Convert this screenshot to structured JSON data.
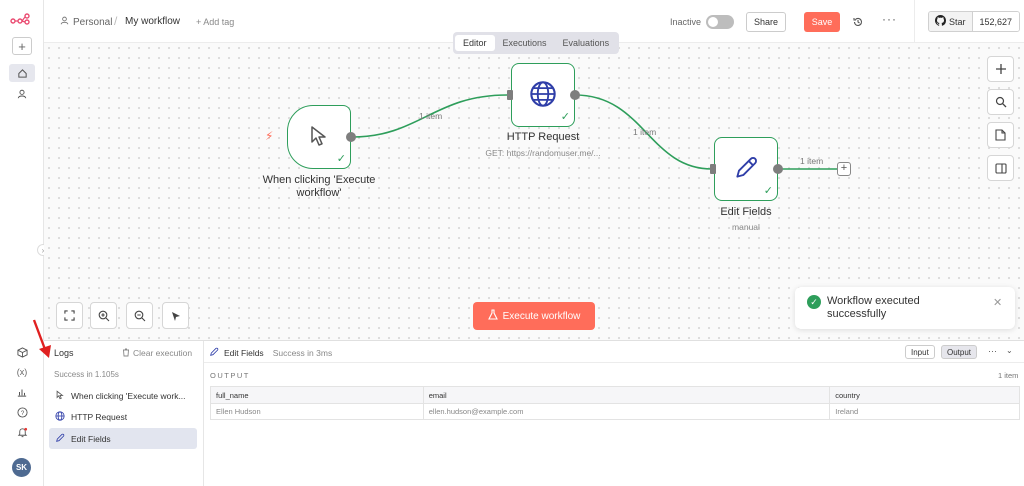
{
  "header": {
    "project": "Personal",
    "separator": "/",
    "workflow_name": "My workflow",
    "add_tag": "+ Add tag",
    "status_label": "Inactive",
    "share_label": "Share",
    "save_label": "Save",
    "more_label": "···",
    "github_star_label": "Star",
    "github_star_count": "152,627"
  },
  "tabs": [
    {
      "label": "Editor",
      "active": true
    },
    {
      "label": "Executions",
      "active": false
    },
    {
      "label": "Evaluations",
      "active": false
    }
  ],
  "nodes": [
    {
      "title": "When clicking 'Execute workflow'",
      "subtitle": ""
    },
    {
      "title": "HTTP Request",
      "subtitle": "GET: https://randomuser.me/..."
    },
    {
      "title": "Edit Fields",
      "subtitle": "manual"
    }
  ],
  "connections": [
    {
      "label": "1 item"
    },
    {
      "label": "1 item"
    },
    {
      "label": "1 item"
    }
  ],
  "canvas": {
    "execute_label": "Execute workflow"
  },
  "toast": {
    "message": "Workflow executed successfully"
  },
  "logs": {
    "title": "Logs",
    "clear_label": "Clear execution",
    "summary": "Success in 1.105s",
    "items": [
      {
        "label": "When clicking 'Execute work..."
      },
      {
        "label": "HTTP Request"
      },
      {
        "label": "Edit Fields"
      }
    ]
  },
  "output": {
    "node_name": "Edit Fields",
    "status": "Success in 3ms",
    "input_label": "Input",
    "output_label": "Output",
    "section_label": "OUTPUT",
    "count_label": "1 item",
    "columns": [
      "full_name",
      "email",
      "country"
    ],
    "rows": [
      [
        "Ellen Hudson",
        "ellen.hudson@example.com",
        "Ireland"
      ]
    ]
  },
  "user": {
    "initials": "SK"
  },
  "colors": {
    "accent": "#ff6d5a",
    "success": "#2e9e5b",
    "node_icon": "#2f3ea8",
    "sidebar_active": "#e6e7ee"
  }
}
